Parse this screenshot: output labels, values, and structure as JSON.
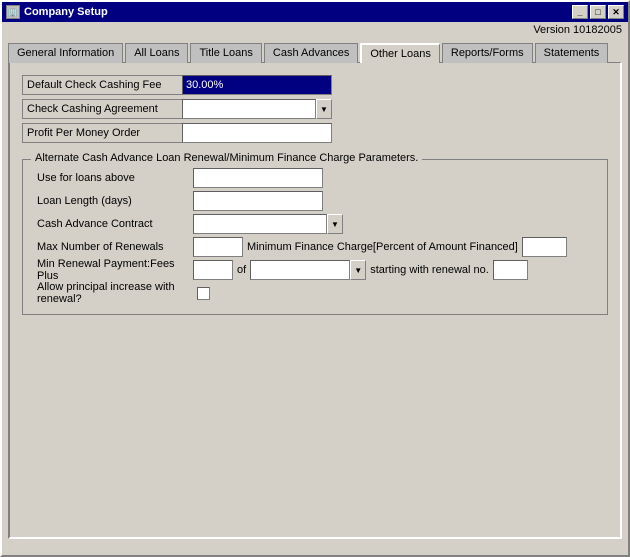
{
  "window": {
    "title": "Company Setup",
    "version": "Version 10182005"
  },
  "tabs": [
    {
      "id": "general",
      "label": "General Information",
      "active": false
    },
    {
      "id": "all-loans",
      "label": "All Loans",
      "active": false
    },
    {
      "id": "title-loans",
      "label": "Title Loans",
      "active": false
    },
    {
      "id": "cash-advances",
      "label": "Cash Advances",
      "active": false
    },
    {
      "id": "other-loans",
      "label": "Other Loans",
      "active": true
    },
    {
      "id": "reports-forms",
      "label": "Reports/Forms",
      "active": false
    },
    {
      "id": "statements",
      "label": "Statements",
      "active": false
    }
  ],
  "form": {
    "default_check_cashing_fee_label": "Default Check Cashing Fee",
    "default_check_cashing_fee_value": "30.00%",
    "check_cashing_agreement_label": "Check Cashing Agreement",
    "check_cashing_agreement_value": "",
    "profit_per_money_order_label": "Profit Per Money Order",
    "profit_per_money_order_value": ""
  },
  "group": {
    "title": "Alternate Cash Advance Loan Renewal/Minimum Finance Charge Parameters.",
    "use_for_loans_above_label": "Use for loans above",
    "use_for_loans_above_value": "",
    "loan_length_label": "Loan Length (days)",
    "loan_length_value": "",
    "cash_advance_contract_label": "Cash Advance Contract",
    "cash_advance_contract_value": "",
    "max_renewals_label": "Max Number of Renewals",
    "max_renewals_value": "",
    "min_finance_charge_label": "Minimum Finance Charge[Percent of Amount Financed]",
    "min_finance_charge_value": "",
    "min_renewal_label": "Min Renewal Payment:Fees Plus",
    "min_renewal_value": "",
    "of_label": "of",
    "starting_with_label": "starting with renewal no.",
    "starting_with_value": "",
    "dropdown_options": [
      ""
    ],
    "allow_principal_label": "Allow principal increase with renewal?",
    "allow_principal_checked": false
  },
  "title_buttons": {
    "minimize": "_",
    "maximize": "□",
    "close": "✕"
  }
}
